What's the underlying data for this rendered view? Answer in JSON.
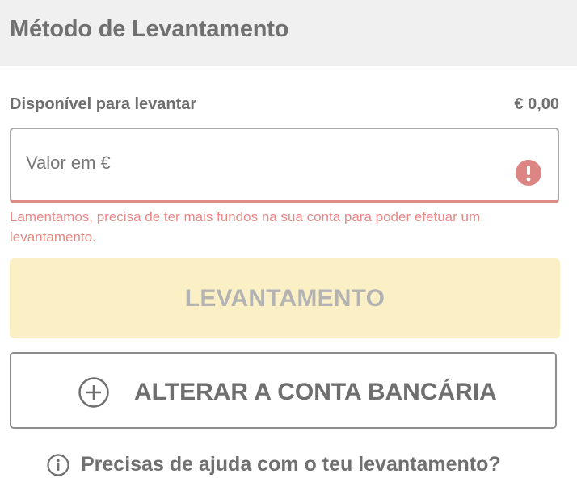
{
  "header": {
    "title": "Método de Levantamento"
  },
  "balance": {
    "label": "Disponível para levantar",
    "value": "€ 0,00"
  },
  "amount_field": {
    "value": "",
    "placeholder": "Valor em €"
  },
  "error": {
    "message": "Lamentamos, precisa de ter mais fundos na sua conta para poder efetuar um levantamento."
  },
  "buttons": {
    "withdraw_label": "LEVANTAMENTO",
    "change_bank_label": "ALTERAR A CONTA BANCÁRIA"
  },
  "help": {
    "label": "Precisas de ajuda com o teu levantamento?"
  },
  "icons": {
    "error": "exclamation-icon",
    "change_bank": "plus-circle-icon",
    "help": "info-icon"
  },
  "colors": {
    "error": "#e58a87",
    "disabled_button_bg": "#fbefc6",
    "disabled_button_text": "#b3b3b3"
  }
}
